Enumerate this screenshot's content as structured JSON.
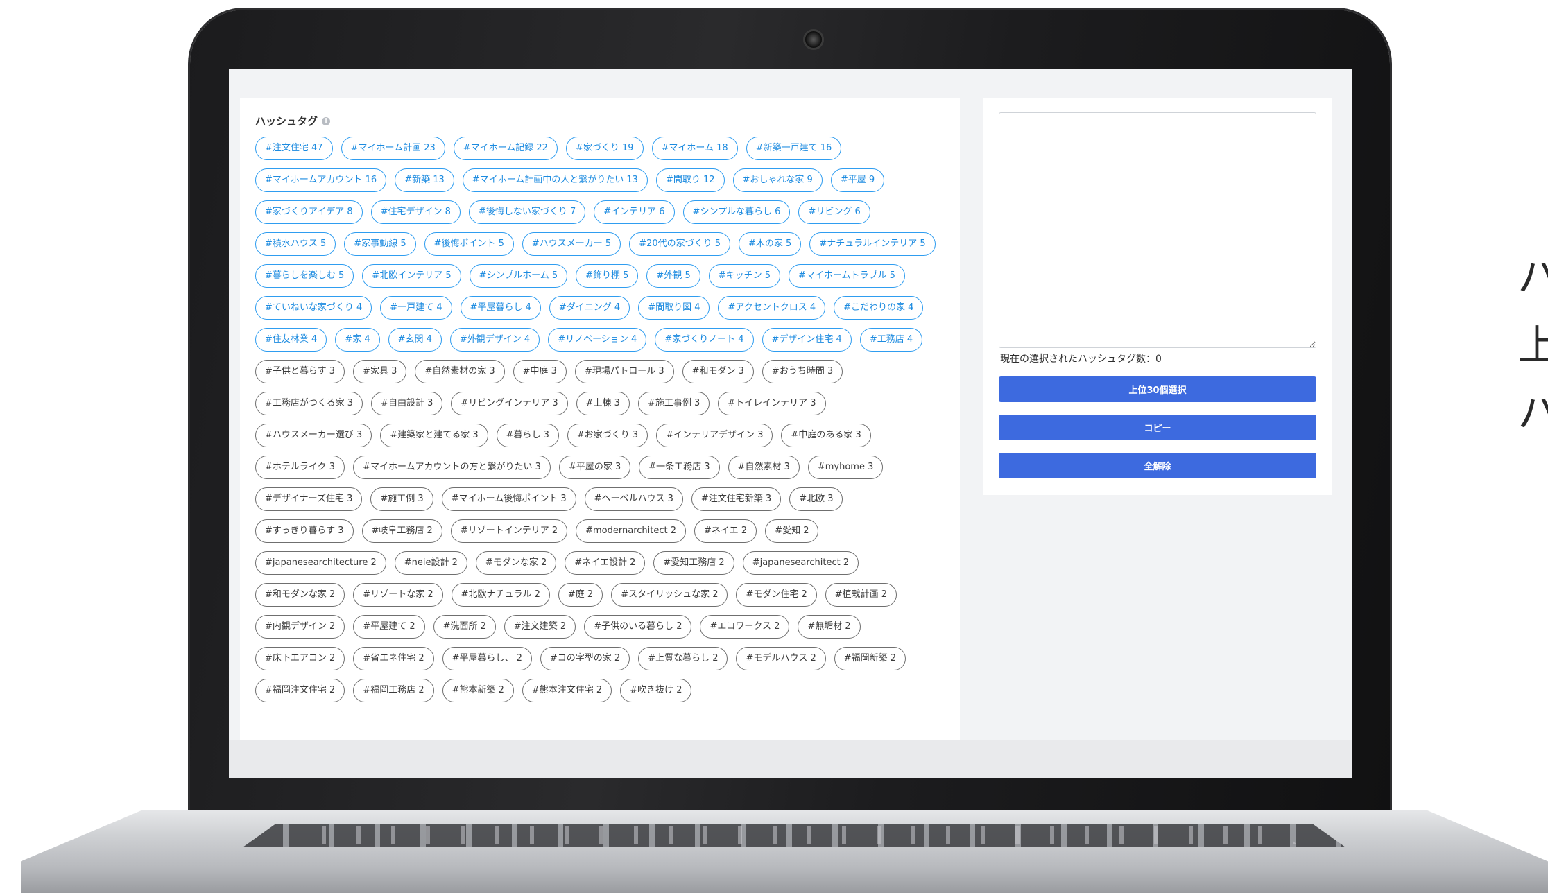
{
  "hashtag_section": {
    "title": "ハッシュタグ",
    "info_icon": "info-circle-icon",
    "tags": [
      {
        "text": "#注文住宅 47",
        "style": "blue"
      },
      {
        "text": "#マイホーム計画 23",
        "style": "blue"
      },
      {
        "text": "#マイホーム記録 22",
        "style": "blue"
      },
      {
        "text": "#家づくり 19",
        "style": "blue"
      },
      {
        "text": "#マイホーム 18",
        "style": "blue"
      },
      {
        "text": "#新築一戸建て 16",
        "style": "blue"
      },
      {
        "text": "#マイホームアカウント 16",
        "style": "blue"
      },
      {
        "text": "#新築 13",
        "style": "blue"
      },
      {
        "text": "#マイホーム計画中の人と繋がりたい 13",
        "style": "blue"
      },
      {
        "text": "#間取り 12",
        "style": "blue"
      },
      {
        "text": "#おしゃれな家 9",
        "style": "blue"
      },
      {
        "text": "#平屋 9",
        "style": "blue"
      },
      {
        "text": "#家づくりアイデア 8",
        "style": "blue"
      },
      {
        "text": "#住宅デザイン 8",
        "style": "blue"
      },
      {
        "text": "#後悔しない家づくり 7",
        "style": "blue"
      },
      {
        "text": "#インテリア 6",
        "style": "blue"
      },
      {
        "text": "#シンプルな暮らし 6",
        "style": "blue"
      },
      {
        "text": "#リビング 6",
        "style": "blue"
      },
      {
        "text": "#積水ハウス 5",
        "style": "blue"
      },
      {
        "text": "#家事動線 5",
        "style": "blue"
      },
      {
        "text": "#後悔ポイント 5",
        "style": "blue"
      },
      {
        "text": "#ハウスメーカー 5",
        "style": "blue"
      },
      {
        "text": "#20代の家づくり 5",
        "style": "blue"
      },
      {
        "text": "#木の家 5",
        "style": "blue"
      },
      {
        "text": "#ナチュラルインテリア 5",
        "style": "blue"
      },
      {
        "text": "#暮らしを楽しむ 5",
        "style": "blue"
      },
      {
        "text": "#北欧インテリア 5",
        "style": "blue"
      },
      {
        "text": "#シンプルホーム 5",
        "style": "blue"
      },
      {
        "text": "#飾り棚 5",
        "style": "blue"
      },
      {
        "text": "#外観 5",
        "style": "blue"
      },
      {
        "text": "#キッチン 5",
        "style": "blue"
      },
      {
        "text": "#マイホームトラブル 5",
        "style": "blue"
      },
      {
        "text": "#ていねいな家づくり 4",
        "style": "blue"
      },
      {
        "text": "#一戸建て 4",
        "style": "blue"
      },
      {
        "text": "#平屋暮らし 4",
        "style": "blue"
      },
      {
        "text": "#ダイニング 4",
        "style": "blue"
      },
      {
        "text": "#間取り図 4",
        "style": "blue"
      },
      {
        "text": "#アクセントクロス 4",
        "style": "blue"
      },
      {
        "text": "#こだわりの家 4",
        "style": "blue"
      },
      {
        "text": "#住友林業 4",
        "style": "blue"
      },
      {
        "text": "#家 4",
        "style": "blue"
      },
      {
        "text": "#玄関 4",
        "style": "blue"
      },
      {
        "text": "#外観デザイン 4",
        "style": "blue"
      },
      {
        "text": "#リノベーション 4",
        "style": "blue"
      },
      {
        "text": "#家づくりノート 4",
        "style": "blue"
      },
      {
        "text": "#デザイン住宅 4",
        "style": "blue"
      },
      {
        "text": "#工務店 4",
        "style": "blue"
      },
      {
        "text": "#子供と暮らす 3",
        "style": "gray"
      },
      {
        "text": "#家具 3",
        "style": "gray"
      },
      {
        "text": "#自然素材の家 3",
        "style": "gray"
      },
      {
        "text": "#中庭 3",
        "style": "gray"
      },
      {
        "text": "#現場パトロール 3",
        "style": "gray"
      },
      {
        "text": "#和モダン 3",
        "style": "gray"
      },
      {
        "text": "#おうち時間 3",
        "style": "gray"
      },
      {
        "text": "#工務店がつくる家 3",
        "style": "gray"
      },
      {
        "text": "#自由設計 3",
        "style": "gray"
      },
      {
        "text": "#リビングインテリア 3",
        "style": "gray"
      },
      {
        "text": "#上棟 3",
        "style": "gray"
      },
      {
        "text": "#施工事例 3",
        "style": "gray"
      },
      {
        "text": "#トイレインテリア 3",
        "style": "gray"
      },
      {
        "text": "#ハウスメーカー選び 3",
        "style": "gray"
      },
      {
        "text": "#建築家と建てる家 3",
        "style": "gray"
      },
      {
        "text": "#暮らし 3",
        "style": "gray"
      },
      {
        "text": "#お家づくり 3",
        "style": "gray"
      },
      {
        "text": "#インテリアデザイン 3",
        "style": "gray"
      },
      {
        "text": "#中庭のある家 3",
        "style": "gray"
      },
      {
        "text": "#ホテルライク 3",
        "style": "gray"
      },
      {
        "text": "#マイホームアカウントの方と繋がりたい 3",
        "style": "gray"
      },
      {
        "text": "#平屋の家 3",
        "style": "gray"
      },
      {
        "text": "#一条工務店 3",
        "style": "gray"
      },
      {
        "text": "#自然素材 3",
        "style": "gray"
      },
      {
        "text": "#myhome 3",
        "style": "gray"
      },
      {
        "text": "#デザイナーズ住宅 3",
        "style": "gray"
      },
      {
        "text": "#施工例 3",
        "style": "gray"
      },
      {
        "text": "#マイホーム後悔ポイント 3",
        "style": "gray"
      },
      {
        "text": "#ヘーベルハウス 3",
        "style": "gray"
      },
      {
        "text": "#注文住宅新築 3",
        "style": "gray"
      },
      {
        "text": "#北欧 3",
        "style": "gray"
      },
      {
        "text": "#すっきり暮らす 3",
        "style": "gray"
      },
      {
        "text": "#岐阜工務店 2",
        "style": "gray"
      },
      {
        "text": "#リゾートインテリア 2",
        "style": "gray"
      },
      {
        "text": "#modernarchitect 2",
        "style": "gray"
      },
      {
        "text": "#ネイエ 2",
        "style": "gray"
      },
      {
        "text": "#愛知 2",
        "style": "gray"
      },
      {
        "text": "#japanesearchitecture 2",
        "style": "gray"
      },
      {
        "text": "#neie設計 2",
        "style": "gray"
      },
      {
        "text": "#モダンな家 2",
        "style": "gray"
      },
      {
        "text": "#ネイエ設計 2",
        "style": "gray"
      },
      {
        "text": "#愛知工務店 2",
        "style": "gray"
      },
      {
        "text": "#japanesearchitect 2",
        "style": "gray"
      },
      {
        "text": "#和モダンな家 2",
        "style": "gray"
      },
      {
        "text": "#リゾートな家 2",
        "style": "gray"
      },
      {
        "text": "#北欧ナチュラル 2",
        "style": "gray"
      },
      {
        "text": "#庭 2",
        "style": "gray"
      },
      {
        "text": "#スタイリッシュな家 2",
        "style": "gray"
      },
      {
        "text": "#モダン住宅 2",
        "style": "gray"
      },
      {
        "text": "#植栽計画 2",
        "style": "gray"
      },
      {
        "text": "#内観デザイン 2",
        "style": "gray"
      },
      {
        "text": "#平屋建て 2",
        "style": "gray"
      },
      {
        "text": "#洗面所 2",
        "style": "gray"
      },
      {
        "text": "#注文建築 2",
        "style": "gray"
      },
      {
        "text": "#子供のいる暮らし 2",
        "style": "gray"
      },
      {
        "text": "#エコワークス 2",
        "style": "gray"
      },
      {
        "text": "#無垢材 2",
        "style": "gray"
      },
      {
        "text": "#床下エアコン 2",
        "style": "gray"
      },
      {
        "text": "#省エネ住宅 2",
        "style": "gray"
      },
      {
        "text": "#平屋暮らし、 2",
        "style": "gray"
      },
      {
        "text": "#コの字型の家 2",
        "style": "gray"
      },
      {
        "text": "#上質な暮らし 2",
        "style": "gray"
      },
      {
        "text": "#モデルハウス 2",
        "style": "gray"
      },
      {
        "text": "#福岡新築 2",
        "style": "gray"
      },
      {
        "text": "#福岡注文住宅 2",
        "style": "gray"
      },
      {
        "text": "#福岡工務店 2",
        "style": "gray"
      },
      {
        "text": "#熊本新築 2",
        "style": "gray"
      },
      {
        "text": "#熊本注文住宅 2",
        "style": "gray"
      },
      {
        "text": "#吹き抜け 2",
        "style": "gray"
      }
    ]
  },
  "selection_panel": {
    "textarea_value": "",
    "count_label": "現在の選択されたハッシュタグ数：0",
    "buttons": {
      "select_top30": "上位30個選択",
      "copy": "コピー",
      "clear_all": "全解除"
    }
  },
  "side_text": {
    "line1": "ハ",
    "line2": "上",
    "line3": "ハ"
  },
  "colors": {
    "tag_blue": "#2f9df0",
    "tag_gray": "#6f6f6f",
    "button": "#3d6adf"
  }
}
